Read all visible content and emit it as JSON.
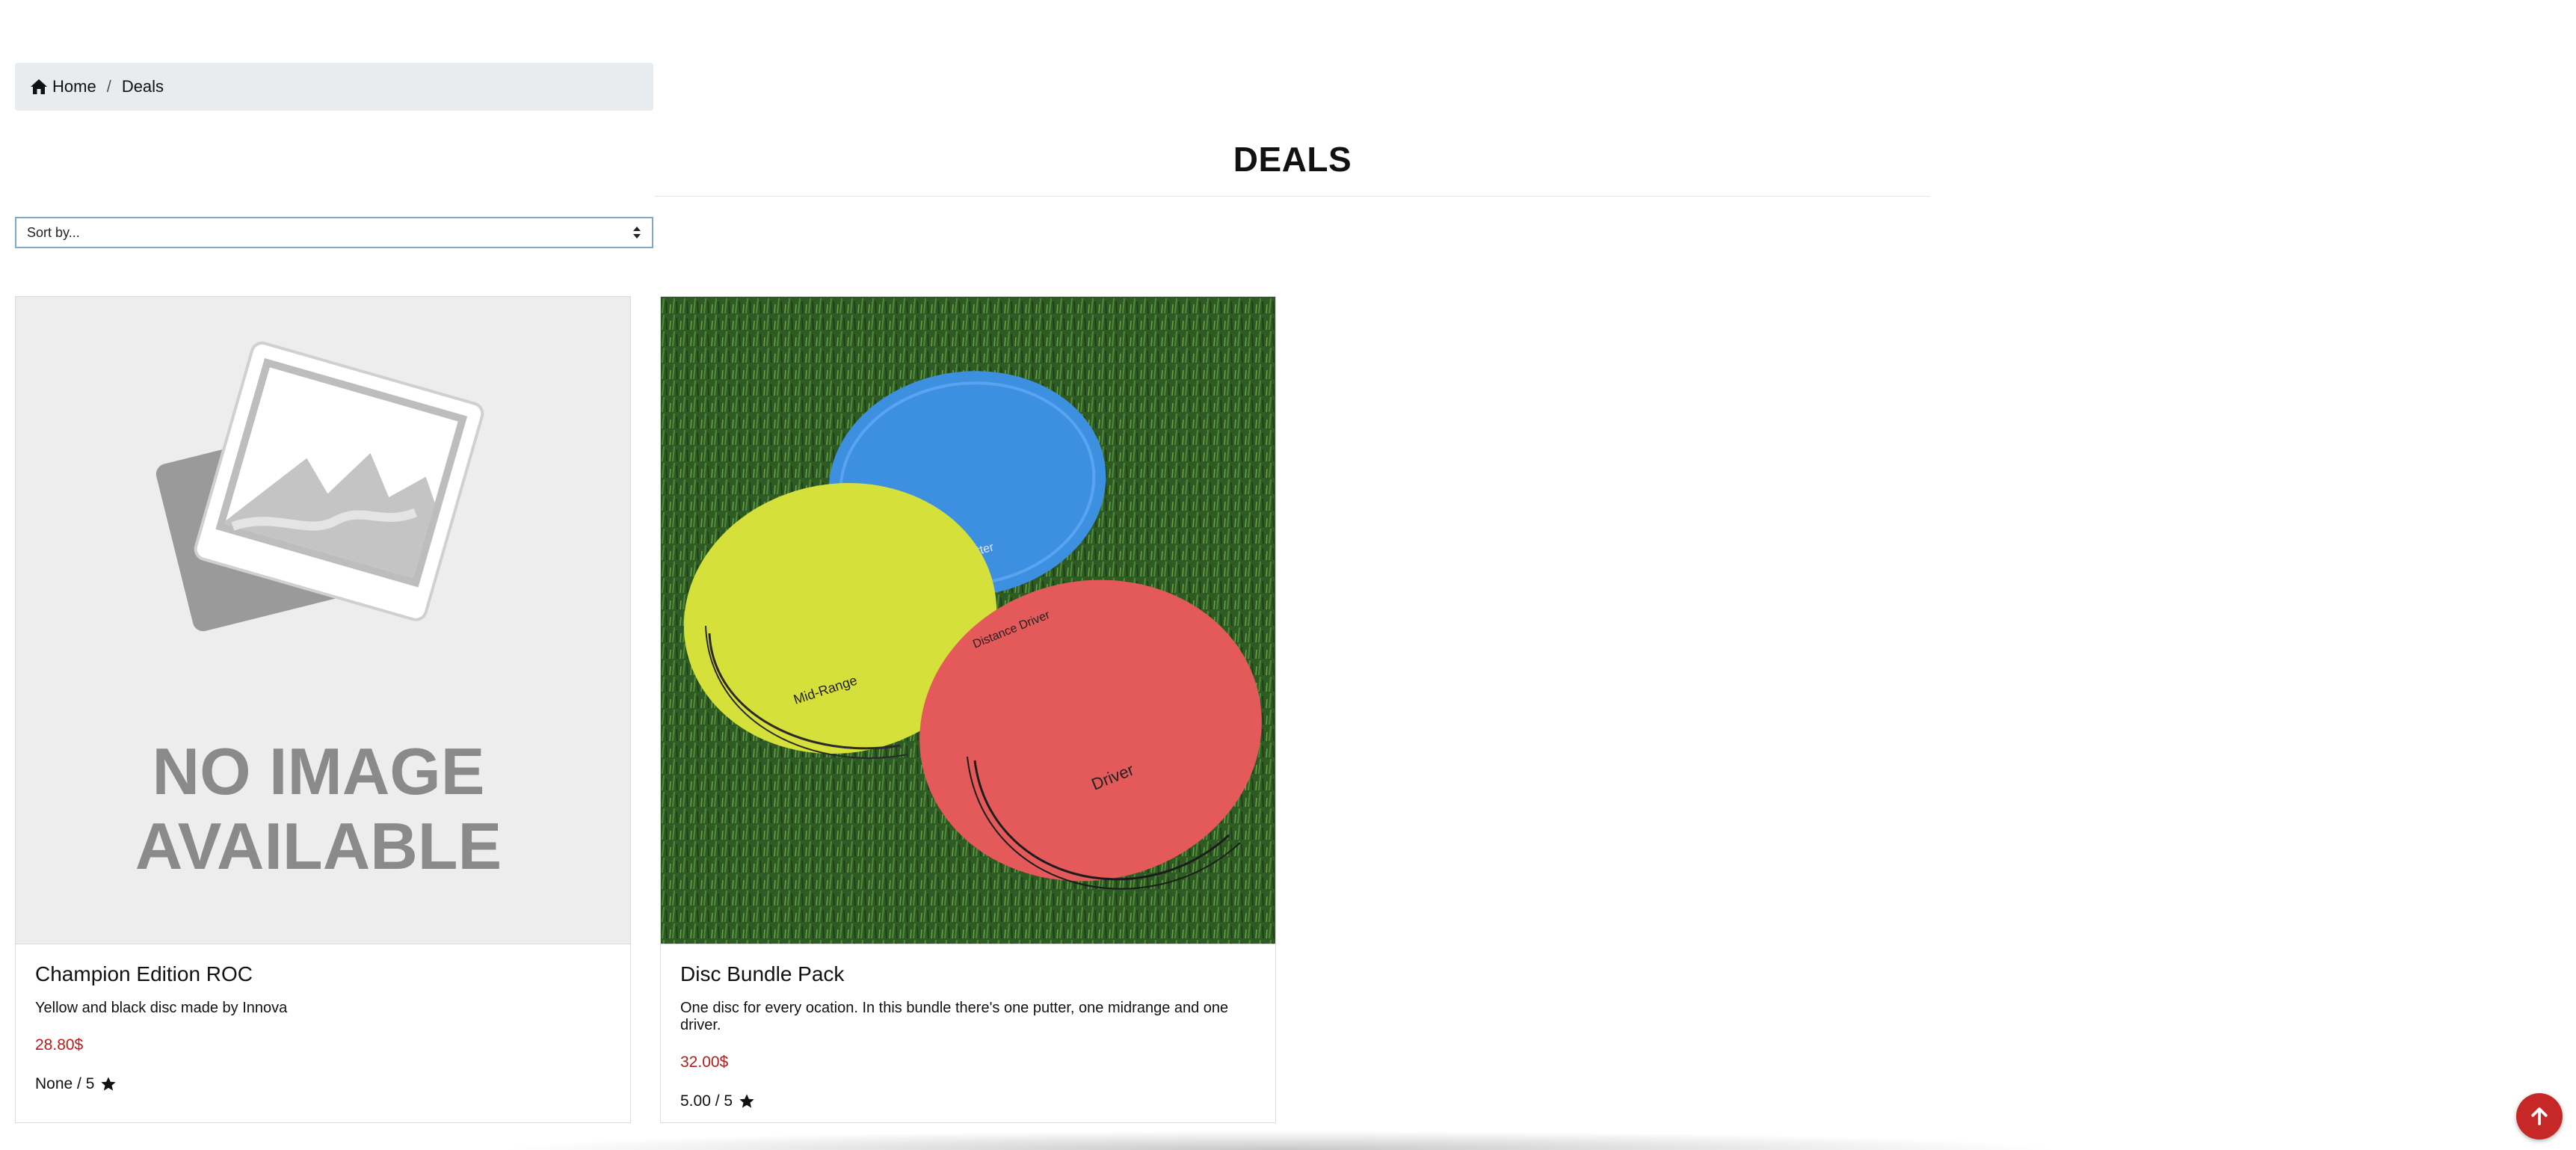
{
  "breadcrumb": {
    "home_label": "Home",
    "separator": "/",
    "current_label": "Deals"
  },
  "page": {
    "title": "DEALS"
  },
  "sort": {
    "selected": "Sort by..."
  },
  "products": [
    {
      "name": "Champion Edition ROC",
      "description": "Yellow and black disc made by Innova",
      "price": "28.80$",
      "rating": "None / 5",
      "image_text_line1": "NO IMAGE",
      "image_text_line2": "AVAILABLE"
    },
    {
      "name": "Disc Bundle Pack",
      "description": "One disc for every ocation. In this bundle there's one putter, one midrange and one driver.",
      "price": "32.00$",
      "rating": "5.00 / 5",
      "disc_labels": {
        "putter": "Putter",
        "midrange": "Mid-Range",
        "driver": "Driver",
        "distance": "Distance Driver"
      }
    }
  ],
  "colors": {
    "price": "#b71c1c",
    "accent": "#c62828",
    "breadcrumb_bg": "#e9ecef"
  },
  "icons": {
    "home": "home-icon",
    "star": "star-icon",
    "scroll_top": "arrow-up-icon"
  }
}
